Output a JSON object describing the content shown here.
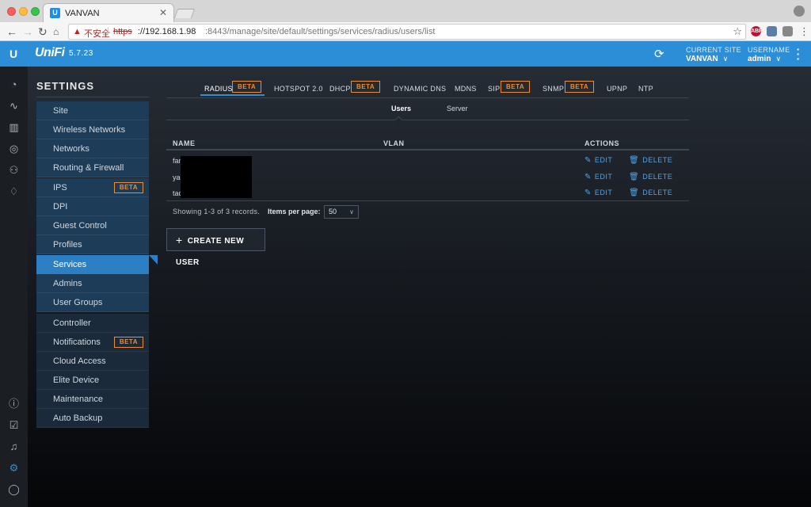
{
  "browser": {
    "tab_title": "VANVAN",
    "tab_favicon": "U",
    "insecure_label": "不安全",
    "url_scheme": "https",
    "url_host": "://192.168.1.98",
    "url_path": ":8443/manage/site/default/settings/services/radius/users/list",
    "ext_abp": "ABP"
  },
  "header": {
    "logo": "U",
    "brand": "UniFi",
    "version": "5.7.23",
    "site_label": "CURRENT SITE",
    "site_value": "VANVAN",
    "user_label": "USERNAME",
    "user_value": "admin",
    "accent": "#2d8ed8"
  },
  "settings": {
    "title": "SETTINGS",
    "items": [
      {
        "label": "Site"
      },
      {
        "label": "Wireless Networks"
      },
      {
        "label": "Networks"
      },
      {
        "label": "Routing & Firewall"
      },
      {
        "label": "IPS",
        "badge": "BETA"
      },
      {
        "label": "DPI"
      },
      {
        "label": "Guest Control"
      },
      {
        "label": "Profiles"
      },
      {
        "label": "Services"
      },
      {
        "label": "Admins"
      },
      {
        "label": "User Groups"
      },
      {
        "label": "Controller"
      },
      {
        "label": "Notifications",
        "badge": "BETA"
      },
      {
        "label": "Cloud Access"
      },
      {
        "label": "Elite Device"
      },
      {
        "label": "Maintenance"
      },
      {
        "label": "Auto Backup"
      }
    ]
  },
  "tabs": [
    {
      "label": "RADIUS",
      "badge": "BETA"
    },
    {
      "label": "HOTSPOT 2.0"
    },
    {
      "label": "DHCP",
      "badge": "BETA"
    },
    {
      "label": "DYNAMIC DNS"
    },
    {
      "label": "MDNS"
    },
    {
      "label": "SIP",
      "badge": "BETA"
    },
    {
      "label": "SNMP",
      "badge": "BETA"
    },
    {
      "label": "UPNP"
    },
    {
      "label": "NTP"
    }
  ],
  "subtabs": [
    "Users",
    "Server"
  ],
  "table": {
    "columns": [
      "NAME",
      "VLAN",
      "ACTIONS"
    ],
    "rows": [
      {
        "name": "fan"
      },
      {
        "name": "yao"
      },
      {
        "name": "tao"
      }
    ],
    "edit_label": "EDIT",
    "delete_label": "DELETE",
    "records": "Showing 1-3 of 3 records.",
    "items_per_page_label": "Items per page:",
    "items_per_page_value": "50"
  },
  "create_button": "CREATE NEW USER",
  "colors": {
    "beta": "#f08c2a",
    "link": "#4fa3e8",
    "active_sidebar": "#2d7fc4"
  }
}
